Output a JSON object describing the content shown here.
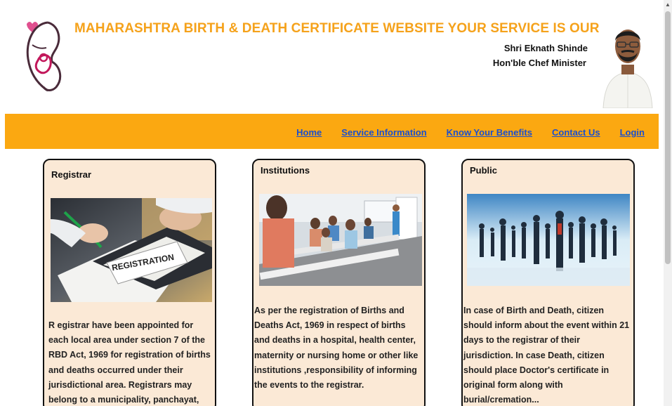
{
  "header": {
    "title": "MAHARASHTRA BIRTH & DEATH CERTIFICATE WEBSITE YOUR SERVICE IS OUR DUTY",
    "minister_name": "Shri Eknath Shinde",
    "minister_role": "Hon'ble Chef Minister"
  },
  "nav": {
    "items": [
      {
        "label": "Home"
      },
      {
        "label": "Service Information"
      },
      {
        "label": "Know Your Benefits"
      },
      {
        "label": "Contact Us"
      },
      {
        "label": "Login"
      }
    ]
  },
  "cards": [
    {
      "title": "Registrar",
      "image_label": "REGISTRATION",
      "text": "R egistrar have been appointed for each local area under section 7 of the RBD Act, 1969 for registration of births and deaths occurred under their jurisdictional area. Registrars may belong to a municipality, panchayat, Gevrnment health institution or"
    },
    {
      "title": "Institutions",
      "text": " As per the registration of Births and Deaths Act, 1969 in   respect of births and deaths in a hospital, health center,      maternity or nursing home or other like institutions ,responsibility of informing the events to the registrar."
    },
    {
      "title": "Public",
      "text": "In case of Birth and Death, citizen should inform about the event within 21 days to the registrar of their jurisdiction. In case Death, citizen should place Doctor's certificate in original form along with burial/cremation..."
    }
  ],
  "colors": {
    "accent": "#f5a21b",
    "navbar": "#fba811",
    "link": "#1a4fcf",
    "card_bg": "#fbe9d6"
  }
}
